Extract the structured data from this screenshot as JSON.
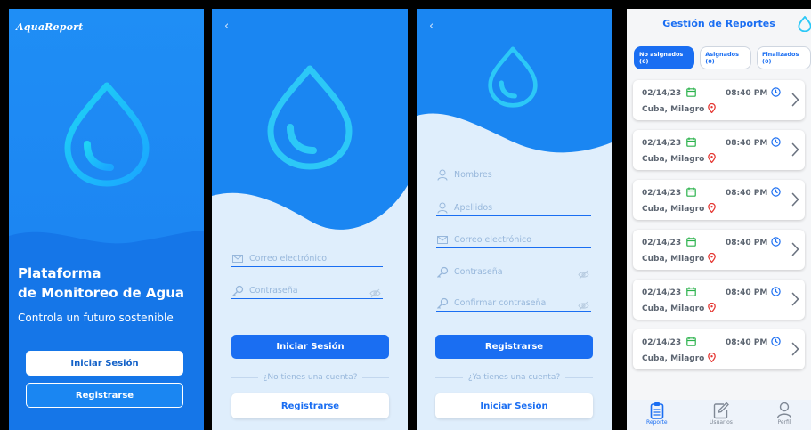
{
  "colors": {
    "primary": "#1a6ef2",
    "sky": "#1a86f2",
    "light_bg": "#dfeefc",
    "calendar_green": "#2bb24c",
    "pin_red": "#e53935"
  },
  "welcome": {
    "brand": "AquaReport",
    "headline_1": "Plataforma",
    "headline_2": "de Monitoreo de Agua",
    "tagline": "Controla un futuro sostenible",
    "login_button": "Iniciar Sesión",
    "register_button": "Registrarse"
  },
  "login": {
    "email_placeholder": "Correo electrónico",
    "password_placeholder": "Contraseña",
    "submit_button": "Iniciar Sesión",
    "no_account_text": "¿No tienes una cuenta?",
    "register_button": "Registrarse"
  },
  "register": {
    "names_placeholder": "Nombres",
    "surnames_placeholder": "Apellidos",
    "email_placeholder": "Correo electrónico",
    "password_placeholder": "Contraseña",
    "confirm_password_placeholder": "Confirmar contraseña",
    "submit_button": "Registrarse",
    "have_account_text": "¿Ya tienes una cuenta?",
    "login_button": "Iniciar Sesión"
  },
  "reports": {
    "title": "Gestión de Reportes",
    "tabs": [
      {
        "label": "No asignados (6)",
        "active": true
      },
      {
        "label": "Asignados (0)",
        "active": false
      },
      {
        "label": "Finalizados (0)",
        "active": false
      }
    ],
    "items": [
      {
        "date": "02/14/23",
        "time": "08:40 PM",
        "location": "Cuba, Milagro"
      },
      {
        "date": "02/14/23",
        "time": "08:40 PM",
        "location": "Cuba, Milagro"
      },
      {
        "date": "02/14/23",
        "time": "08:40 PM",
        "location": "Cuba, Milagro"
      },
      {
        "date": "02/14/23",
        "time": "08:40 PM",
        "location": "Cuba, Milagro"
      },
      {
        "date": "02/14/23",
        "time": "08:40 PM",
        "location": "Cuba, Milagro"
      },
      {
        "date": "02/14/23",
        "time": "08:40 PM",
        "location": "Cuba, Milagro"
      }
    ],
    "nav": [
      {
        "label": "Reporte",
        "icon": "clipboard-icon",
        "active": true
      },
      {
        "label": "Usuarios",
        "icon": "edit-icon",
        "active": false
      },
      {
        "label": "Perfil",
        "icon": "user-icon",
        "active": false
      }
    ]
  }
}
